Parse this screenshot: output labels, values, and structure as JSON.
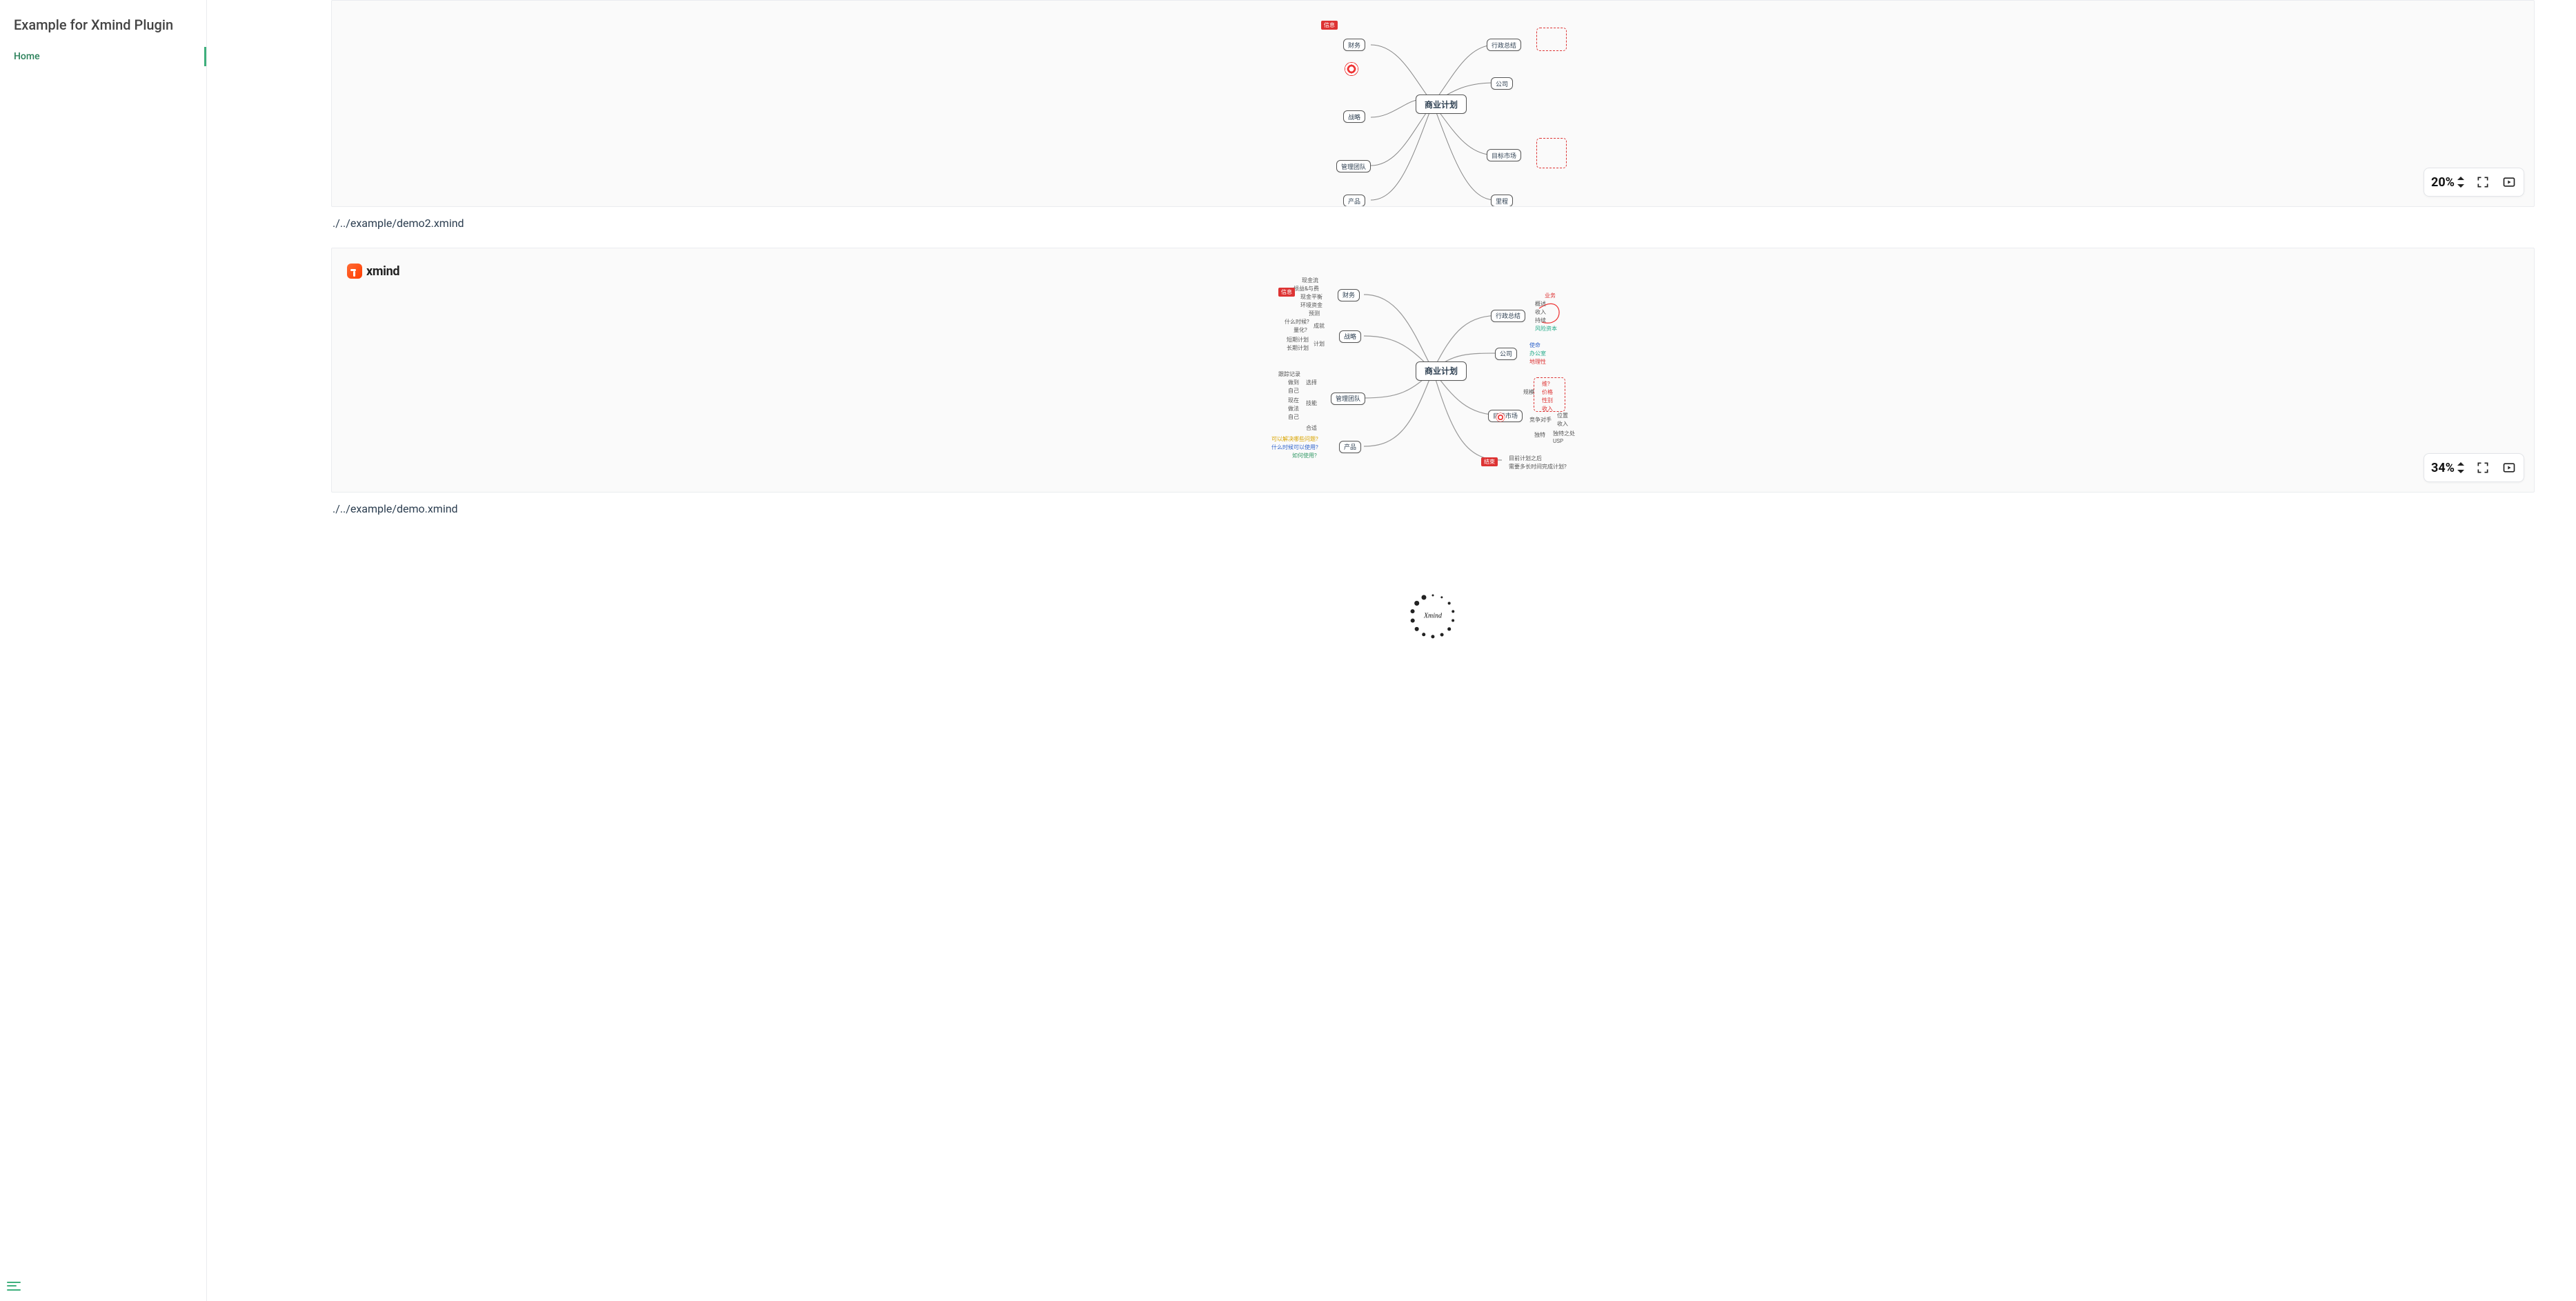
{
  "sidebar": {
    "title": "Example for Xmind Plugin",
    "items": [
      {
        "label": "Home"
      }
    ]
  },
  "brand": {
    "name": "xmind"
  },
  "panels": [
    {
      "id": "panel-a",
      "zoom": "20%",
      "caption": "./../example/demo2.xmind"
    },
    {
      "id": "panel-b",
      "zoom": "34%",
      "caption": "./../example/demo.xmind"
    }
  ],
  "mindmap": {
    "root": "商业计划",
    "left": [
      {
        "title": "财务",
        "children": [
          "现金流",
          "损益&与费",
          "现金平衡",
          "环境资金",
          "预测"
        ],
        "tag": "信息"
      },
      {
        "title": "战略",
        "children_groups": [
          {
            "group": "成就",
            "items": [
              "什么时候?",
              "量化?"
            ]
          },
          {
            "group": "计划",
            "items": [
              "短期计划",
              "长期计划"
            ]
          }
        ]
      },
      {
        "title": "管理团队",
        "children_groups": [
          {
            "group": "选择",
            "items": [
              "跟踪记录",
              "做到",
              "自己"
            ]
          },
          {
            "group": "技能",
            "items": [
              "现在",
              "做法",
              "自己"
            ]
          },
          {
            "group": "合适",
            "items": []
          }
        ]
      },
      {
        "title": "产品",
        "children": [
          "可以解决哪些问题?",
          "什么时候可以使用?",
          "如何使用?"
        ]
      }
    ],
    "right": [
      {
        "title": "行政总结",
        "children": [
          "概述",
          "收入",
          "持续",
          "风险资本"
        ],
        "loop": "业务"
      },
      {
        "title": "公司",
        "children": [
          "使命",
          "办公室",
          "地理性"
        ]
      },
      {
        "title": "目标市场",
        "children_groups": [
          {
            "group": "规模",
            "items": [
              "维?",
              "价格",
              "性别",
              "收入"
            ]
          },
          {
            "group": "竞争对手",
            "items": [
              "位置",
              "收入"
            ]
          },
          {
            "group": "独特",
            "items": [
              "独特之处",
              "USP"
            ]
          }
        ]
      },
      {
        "title": "里程",
        "tag": "结束",
        "children": [
          "目前计划之后",
          "需要多长时间完成计划?"
        ]
      }
    ]
  },
  "loading": {
    "label": "Xmind"
  }
}
